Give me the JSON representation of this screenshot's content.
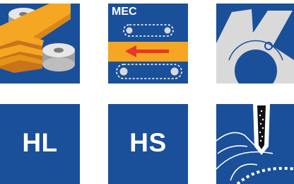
{
  "theme": {
    "tile_blue": "#1a4f99",
    "accent_orange": "#f5a623",
    "arrow_red": "#e8372c",
    "light_grey": "#d9d9d9"
  },
  "tiles": [
    {
      "id": "belt-rollers",
      "icon": "belt-roller-icon"
    },
    {
      "id": "mec",
      "label": "MEC",
      "icon": "conveyor-arrow-icon"
    },
    {
      "id": "blade-disc",
      "icon": "blade-disc-icon"
    },
    {
      "id": "hl",
      "label": "HL"
    },
    {
      "id": "hs",
      "label": "HS"
    },
    {
      "id": "cutting-edge",
      "icon": "cutting-edge-icon"
    }
  ]
}
